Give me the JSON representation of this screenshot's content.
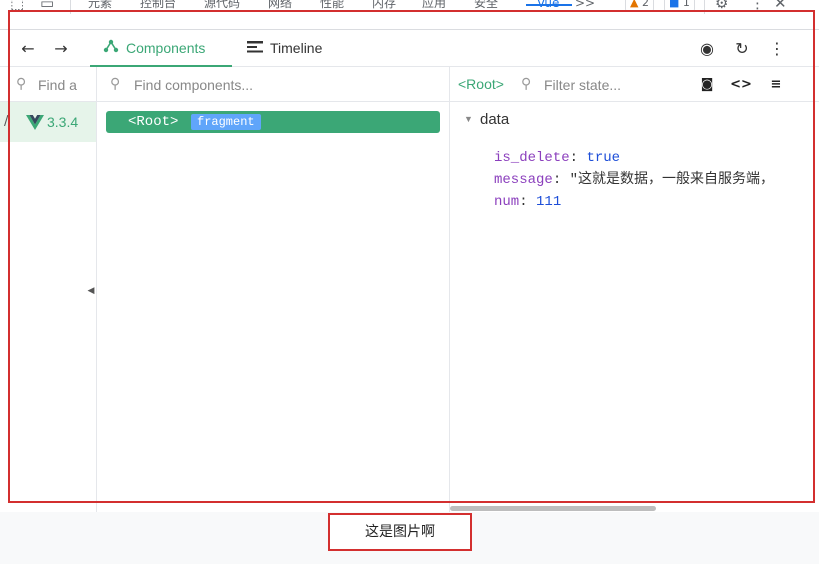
{
  "devtools_tabs": {
    "items": [
      "元素",
      "控制台",
      "源代码",
      "网络",
      "性能",
      "内存",
      "应用",
      "安全",
      "Vue"
    ],
    "active": "Vue",
    "more": ">>",
    "warnings": "2",
    "messages": "1"
  },
  "toolbar": {
    "tabs": [
      {
        "label": "Components",
        "icon": "components-icon",
        "active": true
      },
      {
        "label": "Timeline",
        "icon": "timeline-icon",
        "active": false
      }
    ]
  },
  "left_pane": {
    "search_placeholder": "Find a",
    "app_version": "3.3.4"
  },
  "mid_pane": {
    "search_placeholder": "Find components...",
    "node_tag": "<Root>",
    "node_badge": "fragment"
  },
  "right_pane": {
    "selected": "<Root>",
    "search_placeholder": "Filter state...",
    "section": "data",
    "state": [
      {
        "key": "is_delete",
        "value": "true",
        "kind": "bool"
      },
      {
        "key": "message",
        "value": "\"这就是数据，一般来自服务端，",
        "kind": "str"
      },
      {
        "key": "num",
        "value": "111",
        "kind": "num"
      }
    ]
  },
  "caption": "这是图片啊",
  "colors": {
    "vue_green": "#3ba776",
    "annotation_red": "#d32f2f",
    "badge_blue": "#60a5fa"
  }
}
